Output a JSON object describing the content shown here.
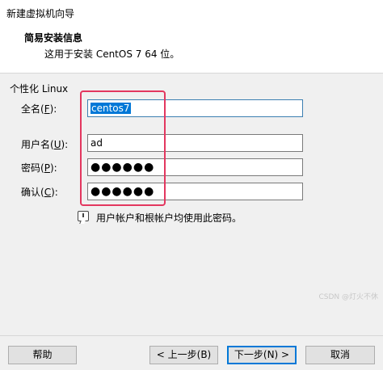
{
  "window": {
    "title": "新建虚拟机向导"
  },
  "header": {
    "title": "简易安装信息",
    "subtitle": "这用于安装 CentOS 7 64 位。"
  },
  "group": {
    "label": "个性化 Linux"
  },
  "fields": {
    "fullname": {
      "label_prefix": "全名(",
      "label_key": "F",
      "label_suffix": "):",
      "value": "centos7"
    },
    "username": {
      "label_prefix": "用户名(",
      "label_key": "U",
      "label_suffix": "):",
      "value": "ad"
    },
    "password": {
      "label_prefix": "密码(",
      "label_key": "P",
      "label_suffix": "):",
      "value": "●●●●●●"
    },
    "confirm": {
      "label_prefix": "确认(",
      "label_key": "C",
      "label_suffix": "):",
      "value": "●●●●●●"
    }
  },
  "note": {
    "icon": "info-comment-icon",
    "text": "用户帐户和根帐户均使用此密码。"
  },
  "buttons": {
    "help": "帮助",
    "back": "< 上一步(B)",
    "next": "下一步(N) >",
    "cancel": "取消"
  },
  "watermark": {
    "body": "CSDN @灯火不休",
    "footer": "CSDN @灯火不休"
  },
  "colors": {
    "highlight": "#e3375f",
    "selection": "#0078d7",
    "dialog_bg": "#f0f0f0"
  }
}
